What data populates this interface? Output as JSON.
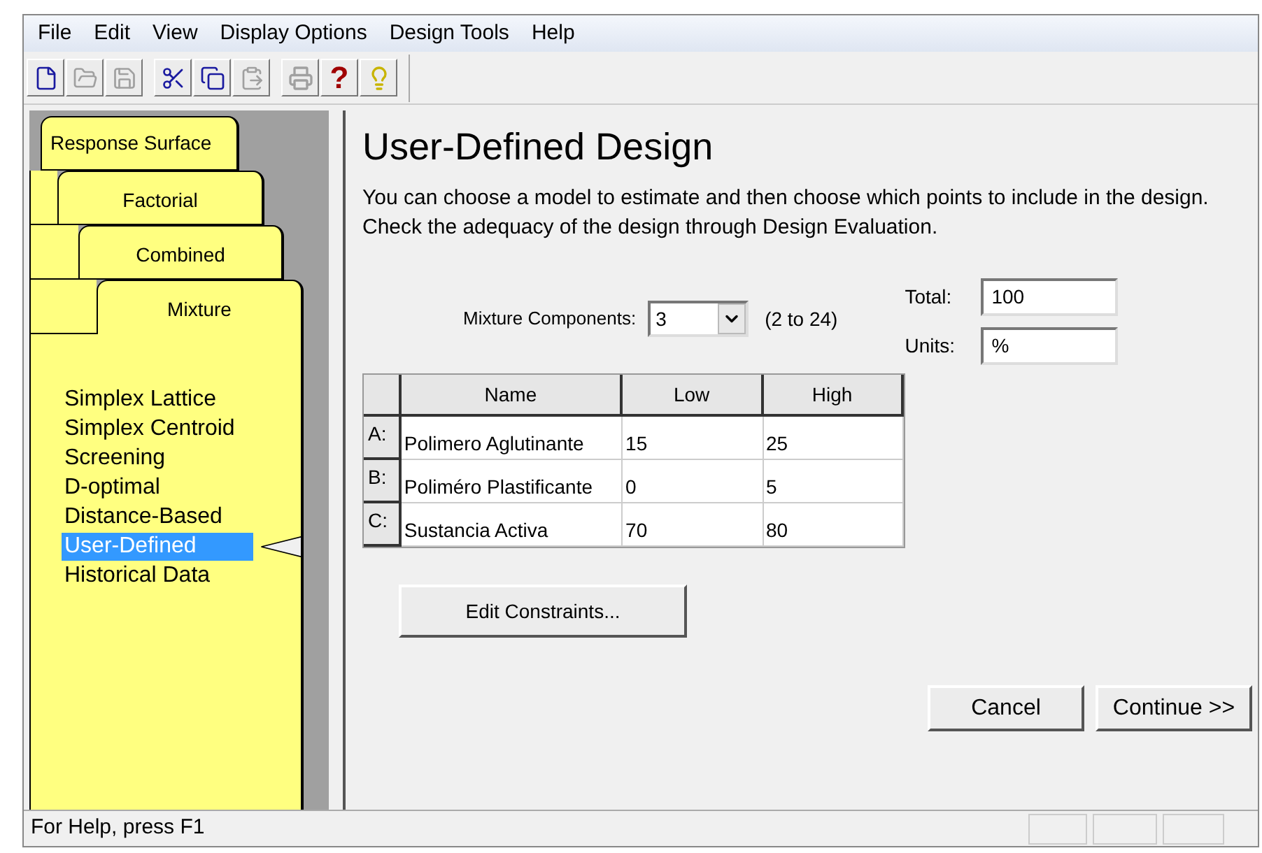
{
  "menu": [
    "File",
    "Edit",
    "View",
    "Display Options",
    "Design Tools",
    "Help"
  ],
  "toolbar": [
    [
      {
        "disabled": false
      },
      {
        "disabled": true
      },
      {
        "disabled": true
      }
    ],
    [
      {
        "disabled": false
      },
      {
        "disabled": false
      },
      {
        "disabled": true
      }
    ],
    [
      {
        "disabled": true
      },
      {
        "disabled": false,
        "label": "?"
      },
      {
        "disabled": false
      }
    ]
  ],
  "tabs": [
    {
      "label": "Response Surface",
      "selected": false
    },
    {
      "label": "Factorial",
      "selected": false
    },
    {
      "label": "Combined",
      "selected": false
    },
    {
      "label": "Mixture",
      "selected": true
    }
  ],
  "design_types": [
    {
      "label": "Simplex Lattice",
      "selected": false
    },
    {
      "label": "Simplex Centroid",
      "selected": false
    },
    {
      "label": "Screening",
      "selected": false
    },
    {
      "label": "D-optimal",
      "selected": false
    },
    {
      "label": "Distance-Based",
      "selected": false
    },
    {
      "label": "User-Defined",
      "selected": true
    },
    {
      "label": "Historical Data",
      "selected": false
    }
  ],
  "title": "User-Defined Design",
  "description": "You can choose a model to estimate and then choose which points to include in the design.  Check the adequacy of the design through Design Evaluation.",
  "components": {
    "label": "Mixture Components:",
    "value": "3",
    "range": "(2 to 24)"
  },
  "total": {
    "label": "Total:",
    "value": "100"
  },
  "units": {
    "label": "Units:",
    "value": "%"
  },
  "table": {
    "columns": [
      "Name",
      "Low",
      "High"
    ],
    "rows": [
      {
        "letter": "A:",
        "cells": [
          "Polimero Aglutinante",
          "15",
          "25"
        ]
      },
      {
        "letter": "B:",
        "cells": [
          "Poliméro Plastificante",
          "0",
          "5"
        ]
      },
      {
        "letter": "C:",
        "cells": [
          "Sustancia Activa",
          "70",
          "80"
        ]
      }
    ]
  },
  "edit_button": "Edit Constraints...",
  "buttons": [
    "Cancel",
    "Continue >>"
  ],
  "status_bar": "For Help, press F1"
}
